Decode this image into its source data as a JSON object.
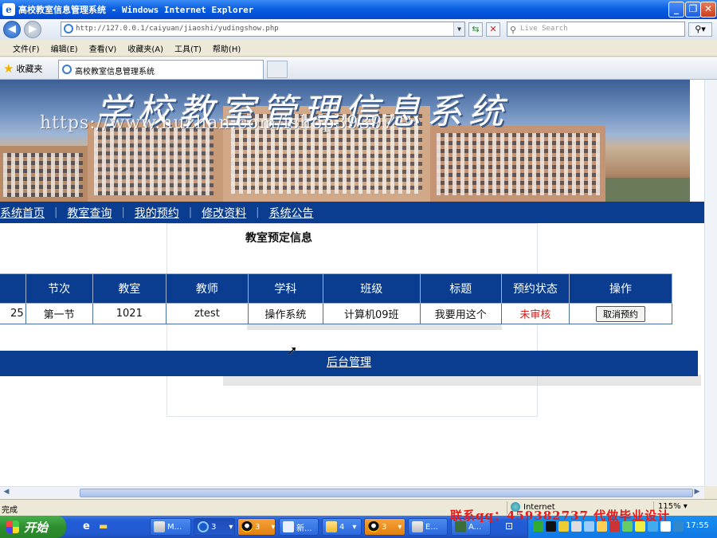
{
  "window": {
    "app_icon_glyph": "e",
    "title": "高校教室信息管理系统 - Windows Internet Explorer",
    "min_glyph": "_",
    "max_glyph": "❐",
    "close_glyph": "✕"
  },
  "address_bar": {
    "back_glyph": "◀",
    "forward_glyph": "▶",
    "url": "http://127.0.0.1/caiyuan/jiaoshi/yudingshow.php",
    "dropdown_glyph": "▼",
    "refresh_glyph": "⇆",
    "stop_glyph": "✕",
    "search_placeholder": "Live Search",
    "search_glyph": "⚲",
    "search_go_glyph": "⚲▾"
  },
  "menu": [
    "文件(F)",
    "编辑(E)",
    "查看(V)",
    "收藏夹(A)",
    "工具(T)",
    "帮助(H)"
  ],
  "favorites": {
    "star_glyph": "★",
    "label": "收藏夹"
  },
  "tab": {
    "label": "高校教室信息管理系统"
  },
  "banner": {
    "heading": "学校教室管理信息系统",
    "watermark": "https://www.huzhan.com/ishop39397"
  },
  "nav": {
    "items": [
      "系统首页",
      "教室查询",
      "我的预约",
      "修改资料",
      "系统公告"
    ],
    "separator": "|"
  },
  "page": {
    "title": "教室预定信息",
    "cursor_glyph": "➚"
  },
  "table": {
    "headers": [
      "",
      "节次",
      "教室",
      "教师",
      "学科",
      "班级",
      "标题",
      "预约状态",
      "操作"
    ],
    "rows": [
      {
        "date": "25",
        "period": "第一节",
        "room": "1021",
        "teacher": "ztest",
        "subject": "操作系统",
        "class": "计算机09班",
        "title": "我要用这个",
        "status": "未审核",
        "action": "取消预约"
      }
    ],
    "status_color": "#d42020"
  },
  "admin_link": "后台管理",
  "scrollbar": {
    "left_glyph": "◀",
    "right_glyph": "▶"
  },
  "statusbar": {
    "text": "完成",
    "zone": "Internet",
    "zoom": "115%",
    "zoom_caret": "▾"
  },
  "overlay_contact": "联系qq：459382737 代做毕业设计",
  "taskbar": {
    "start_label": "开始",
    "quick_ie_glyph": "e",
    "quick_folder_glyph": "▬",
    "tasks": [
      {
        "label": "M..."
      },
      {
        "label": "3"
      },
      {
        "label": "3"
      },
      {
        "label": "新..."
      },
      {
        "label": "4"
      },
      {
        "label": "3"
      },
      {
        "label": "E..."
      },
      {
        "label": "A..."
      }
    ],
    "task_caret": "▾",
    "tray_glyph": "⊡",
    "clock": "17:55"
  }
}
